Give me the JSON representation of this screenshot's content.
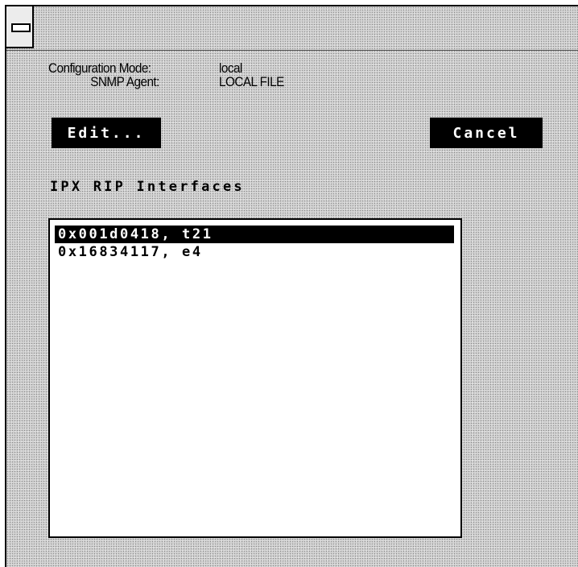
{
  "window": {
    "system_menu_icon": "window-menu-icon"
  },
  "config": {
    "mode_label": "Configuration Mode:",
    "mode_value": "local",
    "agent_label": "SNMP Agent:",
    "agent_value": "LOCAL FILE"
  },
  "buttons": {
    "edit": "Edit...",
    "cancel": "Cancel"
  },
  "section_title": "IPX RIP Interfaces",
  "interfaces": [
    {
      "label": "0x001d0418, t21",
      "selected": true
    },
    {
      "label": "0x16834117, e4",
      "selected": false
    }
  ],
  "colors": {
    "selection": "#000000",
    "button": "#000000",
    "background": "#d4d4d4"
  }
}
